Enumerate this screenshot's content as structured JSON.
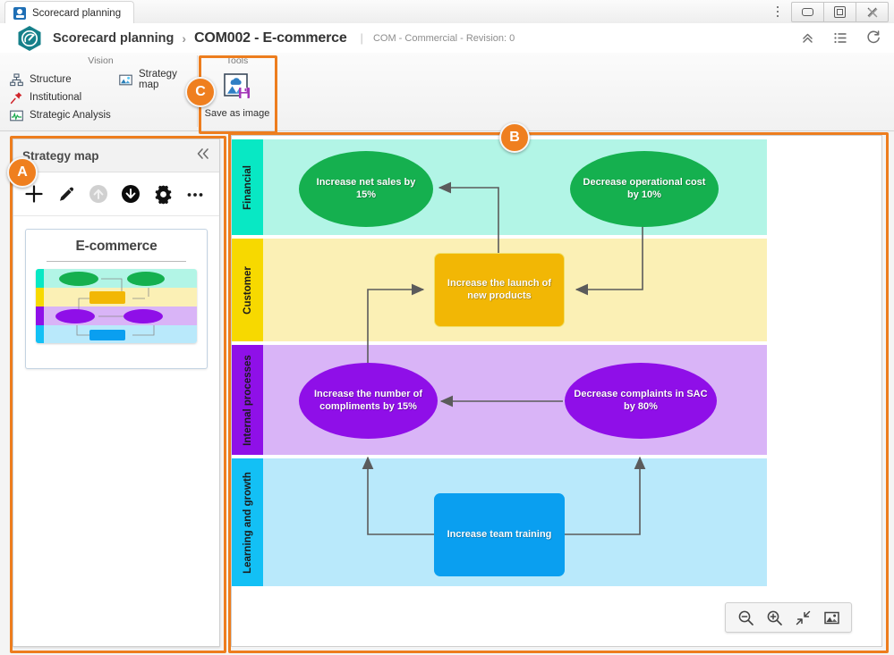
{
  "window": {
    "tab_title": "Scorecard planning",
    "favicon": "app-favicon",
    "overflow_icon": "kebab-menu-icon",
    "minimize_label": "",
    "maximize_label": "",
    "close_label": "✕"
  },
  "header": {
    "logo": "scorecard-hexagon-logo",
    "breadcrumb_app": "Scorecard planning",
    "breadcrumb_sep": "›",
    "breadcrumb_doc": "COM002 - E-commerce",
    "divider": "|",
    "meta": "COM - Commercial - Revision: 0",
    "actions": [
      {
        "name": "collapse-ribbon-icon",
        "glyph": "«"
      },
      {
        "name": "list-view-icon",
        "glyph": "≡"
      },
      {
        "name": "refresh-icon",
        "glyph": "↻"
      }
    ]
  },
  "ribbon": {
    "groups": [
      {
        "title": "Vision",
        "items_col_a": [
          {
            "label": "Structure",
            "icon": "structure-icon"
          },
          {
            "label": "Institutional",
            "icon": "pin-icon"
          },
          {
            "label": "Strategic Analysis",
            "icon": "strategic-analysis-icon"
          }
        ],
        "items_col_b": [
          {
            "label": "Strategy map",
            "icon": "strategy-map-icon"
          }
        ]
      },
      {
        "title": "Tools",
        "tool": {
          "label": "Save as image",
          "icon": "save-as-image-icon"
        }
      }
    ]
  },
  "callouts": [
    {
      "letter": "A",
      "target": "left-panel"
    },
    {
      "letter": "B",
      "target": "canvas"
    },
    {
      "letter": "C",
      "target": "tools-group"
    }
  ],
  "left_panel": {
    "title": "Strategy map",
    "collapse_glyph": "«",
    "toolbar": [
      {
        "name": "add-button",
        "glyph": "+",
        "state": "enabled"
      },
      {
        "name": "edit-button",
        "glyph": "pencil",
        "state": "enabled"
      },
      {
        "name": "move-up-button",
        "glyph": "arrow-up-circle",
        "state": "disabled"
      },
      {
        "name": "move-down-button",
        "glyph": "arrow-down-circle",
        "state": "enabled"
      },
      {
        "name": "settings-button",
        "glyph": "gear",
        "state": "enabled"
      },
      {
        "name": "more-options-button",
        "glyph": "⋯",
        "state": "enabled"
      }
    ],
    "card": {
      "title": "E-commerce"
    }
  },
  "canvas": {
    "lanes": [
      {
        "label": "Financial",
        "tab_color": "#08e8c4",
        "body_color": "#b2f5e6"
      },
      {
        "label": "Customer",
        "tab_color": "#f7d900",
        "body_color": "#fbf0b5"
      },
      {
        "label": "Internal processes",
        "tab_color": "#8f10e8",
        "body_color": "#d9b4f7"
      },
      {
        "label": "Learning and growth",
        "tab_color": "#13c0f5",
        "body_color": "#b9e9fb"
      }
    ],
    "nodes": [
      {
        "id": "n1",
        "label": "Increase net sales by 15%",
        "shape": "ellipse",
        "color": "#15b04f",
        "lane": "Financial"
      },
      {
        "id": "n2",
        "label": "Decrease operational cost by 10%",
        "shape": "ellipse",
        "color": "#15b04f",
        "lane": "Financial"
      },
      {
        "id": "n3",
        "label": "Increase the launch of new products",
        "shape": "rectangle",
        "color": "#f2b705",
        "lane": "Customer"
      },
      {
        "id": "n4",
        "label": "Increase the number of compliments by 15%",
        "shape": "ellipse",
        "color": "#8f0fe8",
        "lane": "Internal processes"
      },
      {
        "id": "n5",
        "label": "Decrease complaints in SAC by 80%",
        "shape": "ellipse",
        "color": "#8f0fe8",
        "lane": "Internal processes"
      },
      {
        "id": "n6",
        "label": "Increase team training",
        "shape": "rectangle",
        "color": "#0a9ff0",
        "lane": "Learning and growth"
      }
    ],
    "connections": [
      {
        "from": "n3",
        "to": "n1"
      },
      {
        "from": "n2",
        "to": "n3"
      },
      {
        "from": "n4",
        "to": "n3"
      },
      {
        "from": "n5",
        "to": "n4"
      },
      {
        "from": "n6",
        "to": "n4"
      },
      {
        "from": "n6",
        "to": "n5"
      }
    ],
    "zoom_controls": [
      {
        "name": "zoom-out-button",
        "glyph": "zoom-out"
      },
      {
        "name": "zoom-in-button",
        "glyph": "zoom-in"
      },
      {
        "name": "fit-to-screen-button",
        "glyph": "fit"
      },
      {
        "name": "image-export-button",
        "glyph": "image"
      }
    ]
  },
  "colors": {
    "accent_orange": "#ef7f1f",
    "logo_teal": "#16808a",
    "green": "#15b04f",
    "yellow": "#f2b705",
    "purple": "#8f0fe8",
    "blue": "#0a9ff0",
    "connector": "#5b5b5b"
  }
}
